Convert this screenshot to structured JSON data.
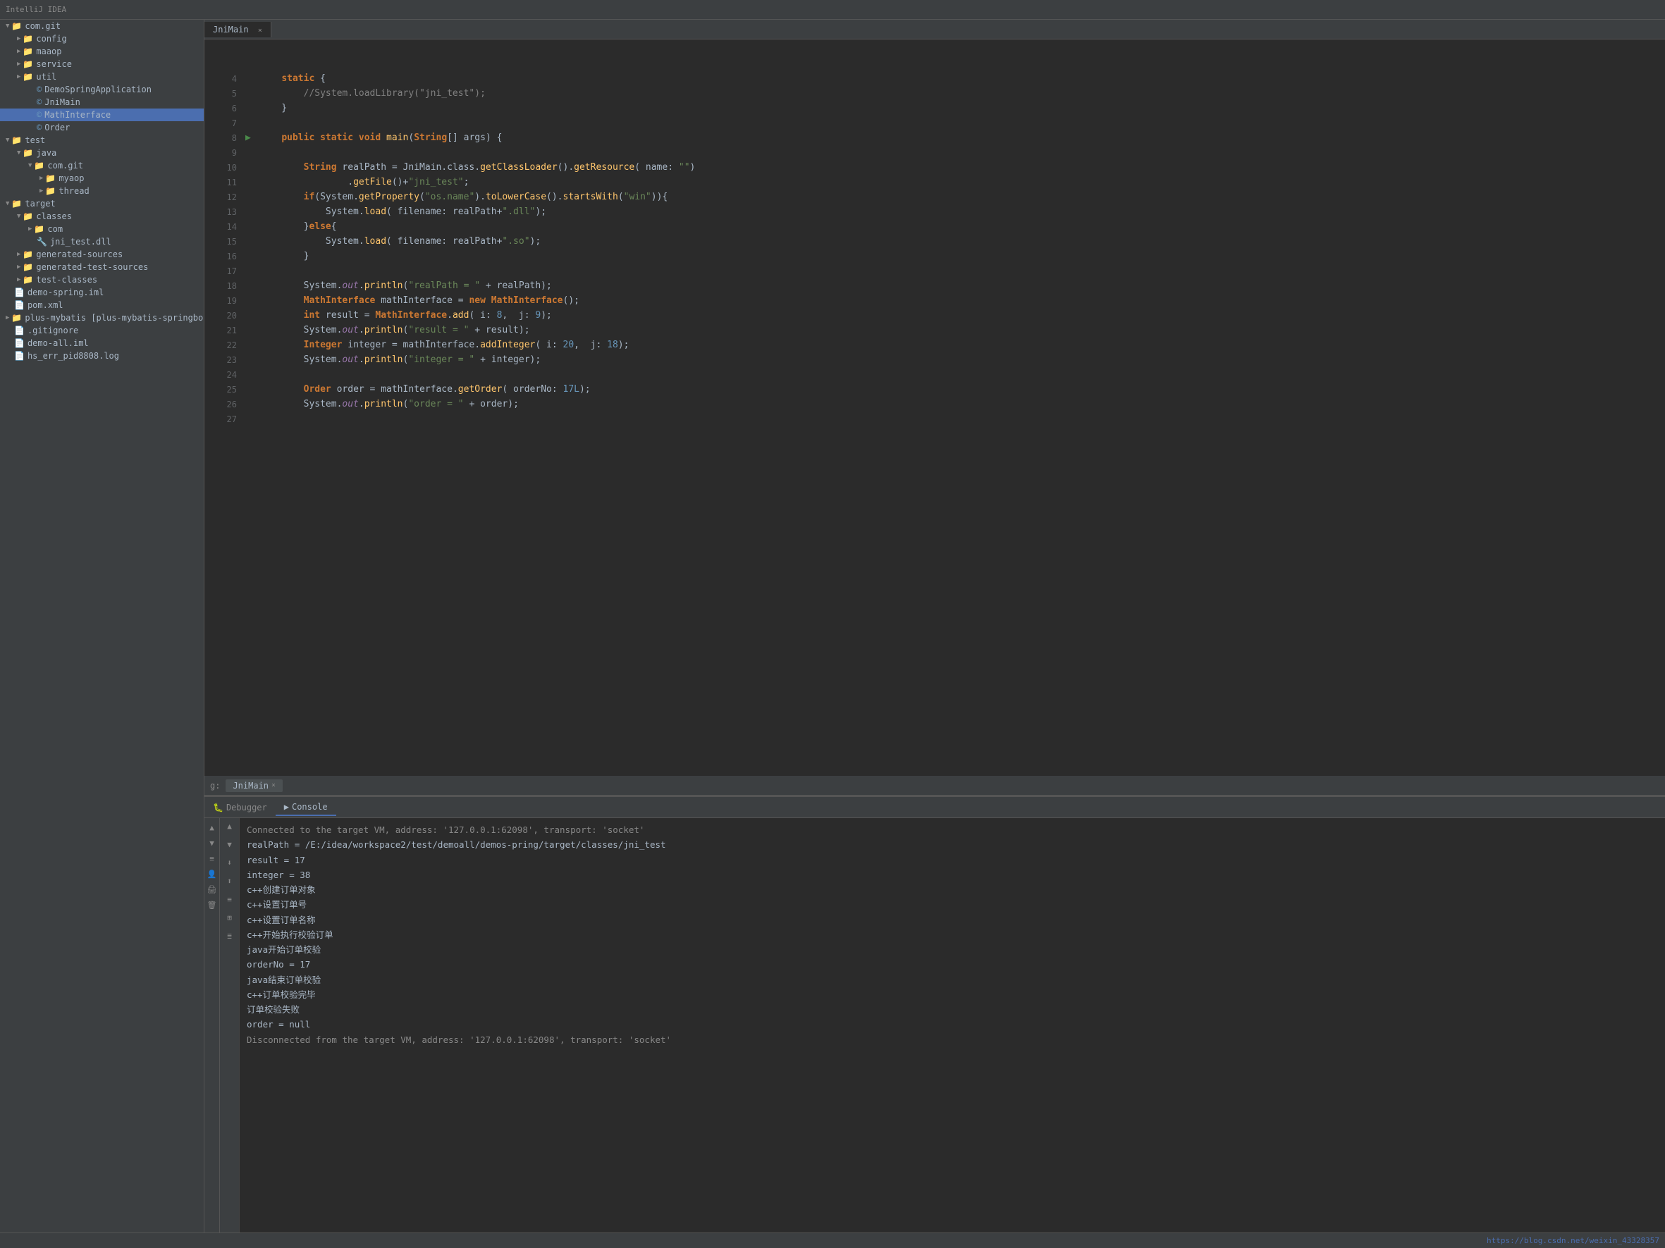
{
  "topBar": {
    "title": "IntelliJ IDEA"
  },
  "sidebar": {
    "items": [
      {
        "id": "com-git",
        "label": "com.git",
        "indent": 0,
        "type": "folder",
        "expanded": true
      },
      {
        "id": "config",
        "label": "config",
        "indent": 1,
        "type": "folder",
        "expanded": false
      },
      {
        "id": "maaop",
        "label": "maaop",
        "indent": 1,
        "type": "folder",
        "expanded": false
      },
      {
        "id": "service",
        "label": "service",
        "indent": 1,
        "type": "folder",
        "expanded": false
      },
      {
        "id": "util",
        "label": "util",
        "indent": 1,
        "type": "folder",
        "expanded": false
      },
      {
        "id": "DemoSpringApplication",
        "label": "DemoSpringApplication",
        "indent": 2,
        "type": "java",
        "expanded": false
      },
      {
        "id": "JniMain",
        "label": "JniMain",
        "indent": 2,
        "type": "java",
        "expanded": false
      },
      {
        "id": "MathInterface",
        "label": "MathInterface",
        "indent": 2,
        "type": "java",
        "selected": true,
        "expanded": false
      },
      {
        "id": "Order",
        "label": "Order",
        "indent": 2,
        "type": "java",
        "expanded": false
      },
      {
        "id": "test",
        "label": "test",
        "indent": 0,
        "type": "folder",
        "expanded": true
      },
      {
        "id": "java",
        "label": "java",
        "indent": 1,
        "type": "folder",
        "expanded": true
      },
      {
        "id": "com-git-2",
        "label": "com.git",
        "indent": 2,
        "type": "folder",
        "expanded": true
      },
      {
        "id": "myaop",
        "label": "myaop",
        "indent": 3,
        "type": "folder",
        "expanded": false
      },
      {
        "id": "thread",
        "label": "thread",
        "indent": 3,
        "type": "folder",
        "expanded": false
      },
      {
        "id": "target",
        "label": "target",
        "indent": 0,
        "type": "folder",
        "expanded": true
      },
      {
        "id": "classes",
        "label": "classes",
        "indent": 1,
        "type": "folder",
        "expanded": true
      },
      {
        "id": "com",
        "label": "com",
        "indent": 2,
        "type": "folder",
        "expanded": false
      },
      {
        "id": "jni_test.dll",
        "label": "jni_test.dll",
        "indent": 2,
        "type": "dll",
        "expanded": false
      },
      {
        "id": "generated-sources",
        "label": "generated-sources",
        "indent": 1,
        "type": "folder",
        "expanded": false
      },
      {
        "id": "generated-test-sources",
        "label": "generated-test-sources",
        "indent": 1,
        "type": "folder",
        "expanded": false
      },
      {
        "id": "test-classes",
        "label": "test-classes",
        "indent": 1,
        "type": "folder",
        "expanded": false
      },
      {
        "id": "demo-spring.iml",
        "label": "demo-spring.iml",
        "indent": 0,
        "type": "iml",
        "expanded": false
      },
      {
        "id": "pom.xml",
        "label": "pom.xml",
        "indent": 0,
        "type": "xml",
        "expanded": false
      },
      {
        "id": "plus-mybatis",
        "label": "plus-mybatis [plus-mybatis-springbo",
        "indent": 0,
        "type": "folder",
        "expanded": false
      },
      {
        "id": "gitignore",
        "label": ".gitignore",
        "indent": 0,
        "type": "file",
        "expanded": false
      },
      {
        "id": "demo-all.iml",
        "label": "demo-all.iml",
        "indent": 0,
        "type": "iml",
        "expanded": false
      },
      {
        "id": "hs_err_pid8808.log",
        "label": "hs_err_pid8808.log",
        "indent": 0,
        "type": "log",
        "expanded": false
      }
    ]
  },
  "editor": {
    "tabs": [
      {
        "label": "JniMain",
        "active": true,
        "closable": true
      }
    ],
    "lines": [
      {
        "num": 4,
        "gutter": "",
        "code": "    static {"
      },
      {
        "num": 5,
        "gutter": "",
        "code": "        //System.loadLibrary(\"jni_test\");"
      },
      {
        "num": 6,
        "gutter": "",
        "code": "    }"
      },
      {
        "num": 7,
        "gutter": "",
        "code": ""
      },
      {
        "num": 8,
        "gutter": "▶",
        "code": "    public static void main(String[] args) {"
      },
      {
        "num": 9,
        "gutter": "",
        "code": ""
      },
      {
        "num": 10,
        "gutter": "",
        "code": "        String realPath = JniMain.class.getClassLoader().getResource( name: \"\")"
      },
      {
        "num": 11,
        "gutter": "",
        "code": "                .getFile()+\"jni_test\";"
      },
      {
        "num": 12,
        "gutter": "",
        "code": "        if(System.getProperty(\"os.name\").toLowerCase().startsWith(\"win\")){"
      },
      {
        "num": 13,
        "gutter": "",
        "code": "            System.load( filename: realPath+\".dll\");"
      },
      {
        "num": 14,
        "gutter": "",
        "code": "        }else{"
      },
      {
        "num": 15,
        "gutter": "",
        "code": "            System.load( filename: realPath+\".so\");"
      },
      {
        "num": 16,
        "gutter": "",
        "code": "        }"
      },
      {
        "num": 17,
        "gutter": "",
        "code": ""
      },
      {
        "num": 18,
        "gutter": "",
        "code": "        System.out.println(\"realPath = \" + realPath);"
      },
      {
        "num": 19,
        "gutter": "",
        "code": "        MathInterface mathInterface = new MathInterface();"
      },
      {
        "num": 20,
        "gutter": "",
        "code": "        int result = MathInterface.add( i: 8,  j: 9);"
      },
      {
        "num": 21,
        "gutter": "",
        "code": "        System.out.println(\"result = \" + result);"
      },
      {
        "num": 22,
        "gutter": "",
        "code": "        Integer integer = mathInterface.addInteger( i: 20,  j: 18);"
      },
      {
        "num": 23,
        "gutter": "",
        "code": "        System.out.println(\"integer = \" + integer);"
      },
      {
        "num": 24,
        "gutter": "",
        "code": ""
      },
      {
        "num": 25,
        "gutter": "",
        "code": "        Order order = mathInterface.getOrder( orderNo: 17L);"
      },
      {
        "num": 26,
        "gutter": "",
        "code": "        System.out.println(\"order = \" + order);"
      },
      {
        "num": 27,
        "gutter": "",
        "code": ""
      }
    ]
  },
  "runBar": {
    "label": "g:",
    "tabLabel": "JniMain",
    "closeLabel": "×"
  },
  "bottomPanel": {
    "tabs": [
      {
        "label": "Debugger",
        "active": false,
        "icon": "bug"
      },
      {
        "label": "Console",
        "active": true,
        "icon": "console"
      }
    ],
    "toolbarButtons": [
      "≡",
      "↑",
      "↓",
      "↓↓",
      "↑↑",
      "⊞",
      "≣"
    ],
    "consoleLines": [
      "Connected to the target VM, address: '127.0.0.1:62098', transport: 'socket'",
      "realPath = /E:/idea/workspace2/test/demoall/demos-pring/target/classes/jni_test",
      "result = 17",
      "integer = 38",
      "c++创建订单对象",
      "c++设置订单号",
      "c++设置订单名称",
      "c++开始执行校验订单",
      "java开始订单校验",
      "orderNo = 17",
      "java结束订单校验",
      "c++订单校验完毕",
      "订单校验失败",
      "order = null",
      "Disconnected from the target VM, address: '127.0.0.1:62098', transport: 'socket'"
    ]
  },
  "statusBar": {
    "rightText": "https://blog.csdn.net/weixin_43328357"
  },
  "leftStrip": {
    "buttons": [
      "↑",
      "↓",
      "≡",
      "👤",
      "🖨",
      "🗑"
    ]
  }
}
